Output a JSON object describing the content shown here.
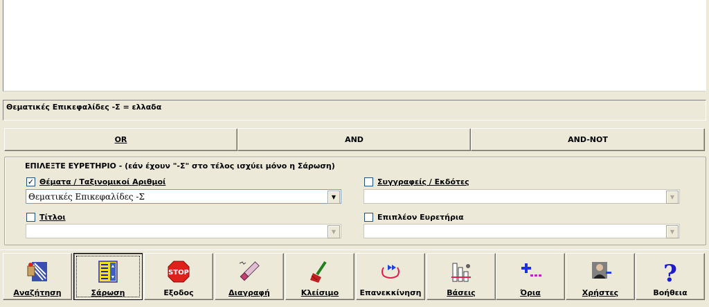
{
  "query_text": "Θεματικές Επικεφαλίδες -Σ = ελλαδα",
  "operators": [
    {
      "label": "OR"
    },
    {
      "label": "AND"
    },
    {
      "label": "AND-NOT"
    }
  ],
  "index_group": {
    "title": "ΕΠΙΛΕΞΤΕ ΕΥΡΕΤΗΡΙΟ - (εάν έχουν \"-Σ\" στο τέλος ισχύει μόνο η Σάρωση)",
    "subjects": {
      "label": "Θέματα / Ταξινομικοί Αριθμοί",
      "checked": true,
      "value": "Θεματικές Επικεφαλίδες -Σ"
    },
    "authors": {
      "label": "Συγγραφείς / Εκδότες",
      "checked": false,
      "value": ""
    },
    "titles": {
      "label": "Τίτλοι",
      "checked": false,
      "value": ""
    },
    "more": {
      "label": "Επιπλέον Ευρετήρια",
      "checked": false,
      "value": ""
    }
  },
  "toolbar": [
    {
      "label": "Αναζήτηση",
      "icon": "search-icon"
    },
    {
      "label": "Σάρωση",
      "icon": "browse-icon"
    },
    {
      "label": "Εξοδος",
      "icon": "stop-icon"
    },
    {
      "label": "Διαγραφή",
      "icon": "eraser-icon"
    },
    {
      "label": "Κλείσιμο",
      "icon": "broom-icon"
    },
    {
      "label": "Επανεκκίνηση",
      "icon": "restart-icon"
    },
    {
      "label": "Βάσεις",
      "icon": "databases-icon"
    },
    {
      "label": "Όρια",
      "icon": "limits-icon"
    },
    {
      "label": "Χρήστες",
      "icon": "users-icon"
    },
    {
      "label": "Βοήθεια",
      "icon": "help-icon"
    }
  ],
  "colors": {
    "window_bg": "#ece9d8",
    "stop_red": "#e0201a",
    "help_blue": "#1c1ccc"
  }
}
